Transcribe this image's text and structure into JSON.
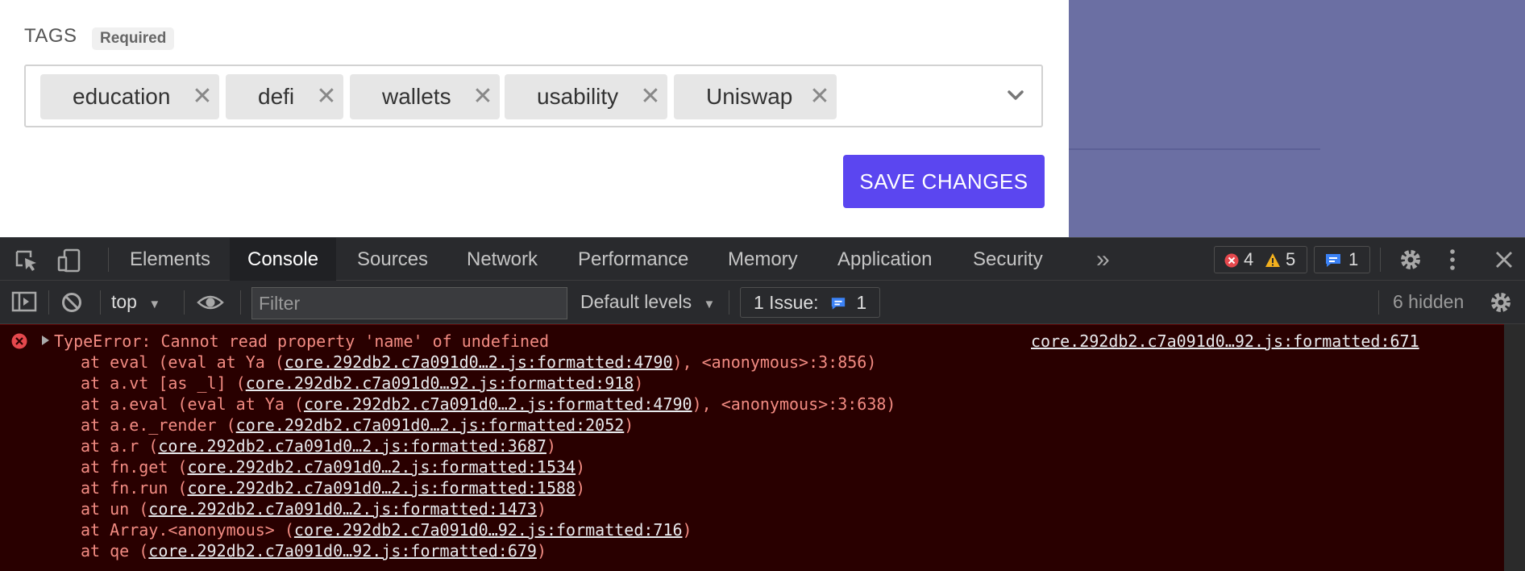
{
  "form": {
    "tags_label": "TAGS",
    "required_badge": "Required",
    "tags": [
      {
        "label": "education"
      },
      {
        "label": "defi"
      },
      {
        "label": "wallets"
      },
      {
        "label": "usability"
      },
      {
        "label": "Uniswap"
      }
    ],
    "remove_glyph": "✕",
    "save_label": "SAVE CHANGES",
    "colors": {
      "save_button": "#5b46f0",
      "side_panel": "#6b6fa3"
    }
  },
  "devtools": {
    "tabs": [
      {
        "label": "Elements"
      },
      {
        "label": "Console",
        "active": true
      },
      {
        "label": "Sources"
      },
      {
        "label": "Network"
      },
      {
        "label": "Performance"
      },
      {
        "label": "Memory"
      },
      {
        "label": "Application"
      },
      {
        "label": "Security"
      }
    ],
    "more_tabs_glyph": "»",
    "counters": {
      "errors": "4",
      "warnings": "5",
      "messages": "1"
    },
    "toolbar": {
      "context": "top",
      "filter_placeholder": "Filter",
      "levels": "Default levels",
      "issues_label": "1 Issue:",
      "issues_count": "1",
      "hidden": "6 hidden"
    },
    "console": {
      "error_title": "TypeError: Cannot read property 'name' of undefined",
      "error_source": "core.292db2.c7a091d0…92.js:formatted:671",
      "stack": [
        {
          "prefix": "at eval (eval at Ya (",
          "link": "core.292db2.c7a091d0…2.js:formatted:4790",
          "suffix": "), <anonymous>:3:856)"
        },
        {
          "prefix": "at a.vt [as _l] (",
          "link": "core.292db2.c7a091d0…92.js:formatted:918",
          "suffix": ")"
        },
        {
          "prefix": "at a.eval (eval at Ya (",
          "link": "core.292db2.c7a091d0…2.js:formatted:4790",
          "suffix": "), <anonymous>:3:638)"
        },
        {
          "prefix": "at a.e._render (",
          "link": "core.292db2.c7a091d0…2.js:formatted:2052",
          "suffix": ")"
        },
        {
          "prefix": "at a.r (",
          "link": "core.292db2.c7a091d0…2.js:formatted:3687",
          "suffix": ")"
        },
        {
          "prefix": "at fn.get (",
          "link": "core.292db2.c7a091d0…2.js:formatted:1534",
          "suffix": ")"
        },
        {
          "prefix": "at fn.run (",
          "link": "core.292db2.c7a091d0…2.js:formatted:1588",
          "suffix": ")"
        },
        {
          "prefix": "at un (",
          "link": "core.292db2.c7a091d0…2.js:formatted:1473",
          "suffix": ")"
        },
        {
          "prefix": "at Array.<anonymous> (",
          "link": "core.292db2.c7a091d0…92.js:formatted:716",
          "suffix": ")"
        },
        {
          "prefix": "at qe (",
          "link": "core.292db2.c7a091d0…92.js:formatted:679",
          "suffix": ")"
        }
      ]
    }
  }
}
